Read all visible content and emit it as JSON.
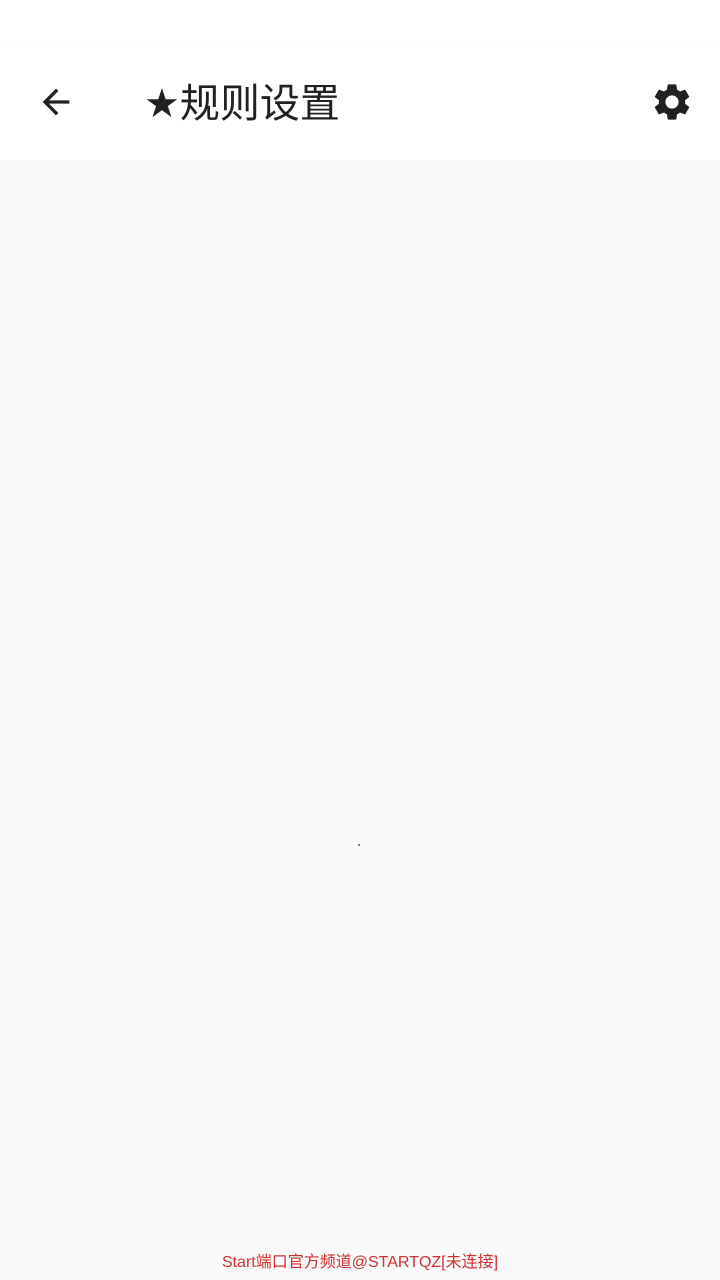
{
  "header": {
    "title": "★规则设置",
    "back_icon": "arrow-back-icon",
    "settings_icon": "gear-icon"
  },
  "footer": {
    "text": "Start端口官方频道@STARTQZ[未连接]",
    "color": "#d32f2f"
  },
  "colors": {
    "background": "#fafafa",
    "app_bar": "#ffffff",
    "text_primary": "#212121"
  }
}
